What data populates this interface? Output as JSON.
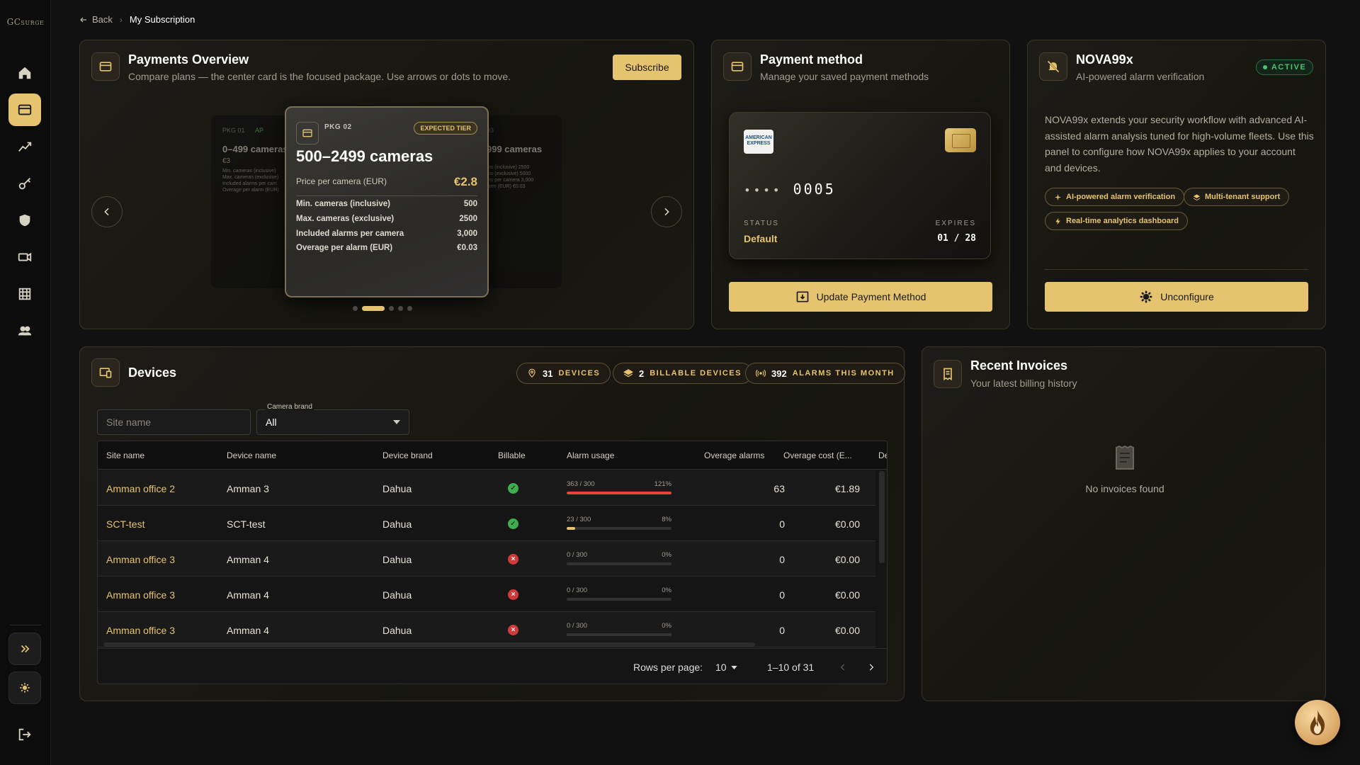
{
  "app": {
    "logo_text": "GC SURGE",
    "accent_color": "#e6c36f"
  },
  "sidebar": {
    "items": [
      {
        "name": "home-icon"
      },
      {
        "name": "credit-card-icon",
        "active": true
      },
      {
        "name": "analytics-icon"
      },
      {
        "name": "key-icon"
      },
      {
        "name": "shield-icon"
      },
      {
        "name": "camera-icon"
      },
      {
        "name": "grid-icon"
      },
      {
        "name": "users-icon"
      }
    ]
  },
  "breadcrumb": {
    "back_label": "Back",
    "current": "My Subscription"
  },
  "payments_overview": {
    "title": "Payments Overview",
    "subtitle": "Compare plans — the center card is the focused package. Use arrows or dots to move.",
    "subscribe_label": "Subscribe",
    "left_package": {
      "label": "PKG 01",
      "badge": "AP",
      "title": "0–499 cameras",
      "price": "€3",
      "lines": [
        "Min. cameras (inclusive)",
        "Max. cameras (exclusive)",
        "Included alarms per cam",
        "Overage per alarm (EUR)"
      ]
    },
    "focused_package": {
      "label": "PKG 02",
      "tier_badge": "EXPECTED TIER",
      "title": "500–2499 cameras",
      "price_label": "Price per camera (EUR)",
      "price_value": "€2.8",
      "rows": [
        {
          "label": "Min. cameras (inclusive)",
          "value": "500"
        },
        {
          "label": "Max. cameras (exclusive)",
          "value": "2500"
        },
        {
          "label": "Included alarms per camera",
          "value": "3,000"
        },
        {
          "label": "Overage per alarm (EUR)",
          "value": "€0.03"
        }
      ]
    },
    "right_package": {
      "label": "03",
      "title": "999 cameras",
      "lines": [
        "ms (inclusive) 2500",
        "ms (exclusive) 5000",
        "ms per camera 3,000",
        "larm (EUR) €0.03"
      ]
    },
    "dots_count": 5,
    "active_dot": 1
  },
  "payment_method": {
    "title": "Payment method",
    "subtitle": "Manage your saved payment methods",
    "card_brand": "AMERICAN EXPRESS",
    "masked": "••••",
    "last4": "0005",
    "status_label": "STATUS",
    "status_value": "Default",
    "expires_label": "EXPIRES",
    "expires_value": "01 / 28",
    "update_label": "Update Payment Method"
  },
  "nova": {
    "title": "NOVA99x",
    "subtitle": "AI-powered alarm verification",
    "status": "ACTIVE",
    "status_color": "#4fc26b",
    "description": "NOVA99x extends your security workflow with advanced AI-assisted alarm analysis tuned for high-volume fleets. Use this panel to configure how NOVA99x applies to your account and devices.",
    "tags": [
      "AI-powered alarm verification",
      "Multi-tenant support",
      "Real-time analytics dashboard"
    ],
    "unconfigure_label": "Unconfigure"
  },
  "devices": {
    "title": "Devices",
    "stats": [
      {
        "count": "31",
        "label": "DEVICES"
      },
      {
        "count": "2",
        "label": "BILLABLE DEVICES"
      },
      {
        "count": "392",
        "label": "ALARMS THIS MONTH"
      }
    ],
    "site_placeholder": "Site name",
    "brand_label": "Camera brand",
    "brand_value": "All",
    "columns": [
      "Site name",
      "Device name",
      "Device brand",
      "Billable",
      "Alarm usage",
      "Overage alarms",
      "Overage cost (E...",
      "De"
    ],
    "rows": [
      {
        "site": "Amman office 2",
        "device": "Amman 3",
        "brand": "Dahua",
        "billable": true,
        "usage_text": "363 / 300",
        "usage_pct": "121%",
        "fill": 1.0,
        "overage": "63",
        "cost": "€1.89"
      },
      {
        "site": "SCT-test",
        "device": "SCT-test",
        "brand": "Dahua",
        "billable": true,
        "usage_text": "23 / 300",
        "usage_pct": "8%",
        "fill": 0.08,
        "overage": "0",
        "cost": "€0.00"
      },
      {
        "site": "Amman office 3",
        "device": "Amman 4",
        "brand": "Dahua",
        "billable": false,
        "usage_text": "0 / 300",
        "usage_pct": "0%",
        "fill": 0,
        "overage": "0",
        "cost": "€0.00"
      },
      {
        "site": "Amman office 3",
        "device": "Amman 4",
        "brand": "Dahua",
        "billable": false,
        "usage_text": "0 / 300",
        "usage_pct": "0%",
        "fill": 0,
        "overage": "0",
        "cost": "€0.00"
      },
      {
        "site": "Amman office 3",
        "device": "Amman 4",
        "brand": "Dahua",
        "billable": false,
        "usage_text": "0 / 300",
        "usage_pct": "0%",
        "fill": 0,
        "overage": "0",
        "cost": "€0.00"
      }
    ],
    "rows_per_page_label": "Rows per page:",
    "rows_per_page_value": "10",
    "range": "1–10 of 31"
  },
  "invoices": {
    "title": "Recent Invoices",
    "subtitle": "Your latest billing history",
    "empty_text": "No invoices found"
  }
}
